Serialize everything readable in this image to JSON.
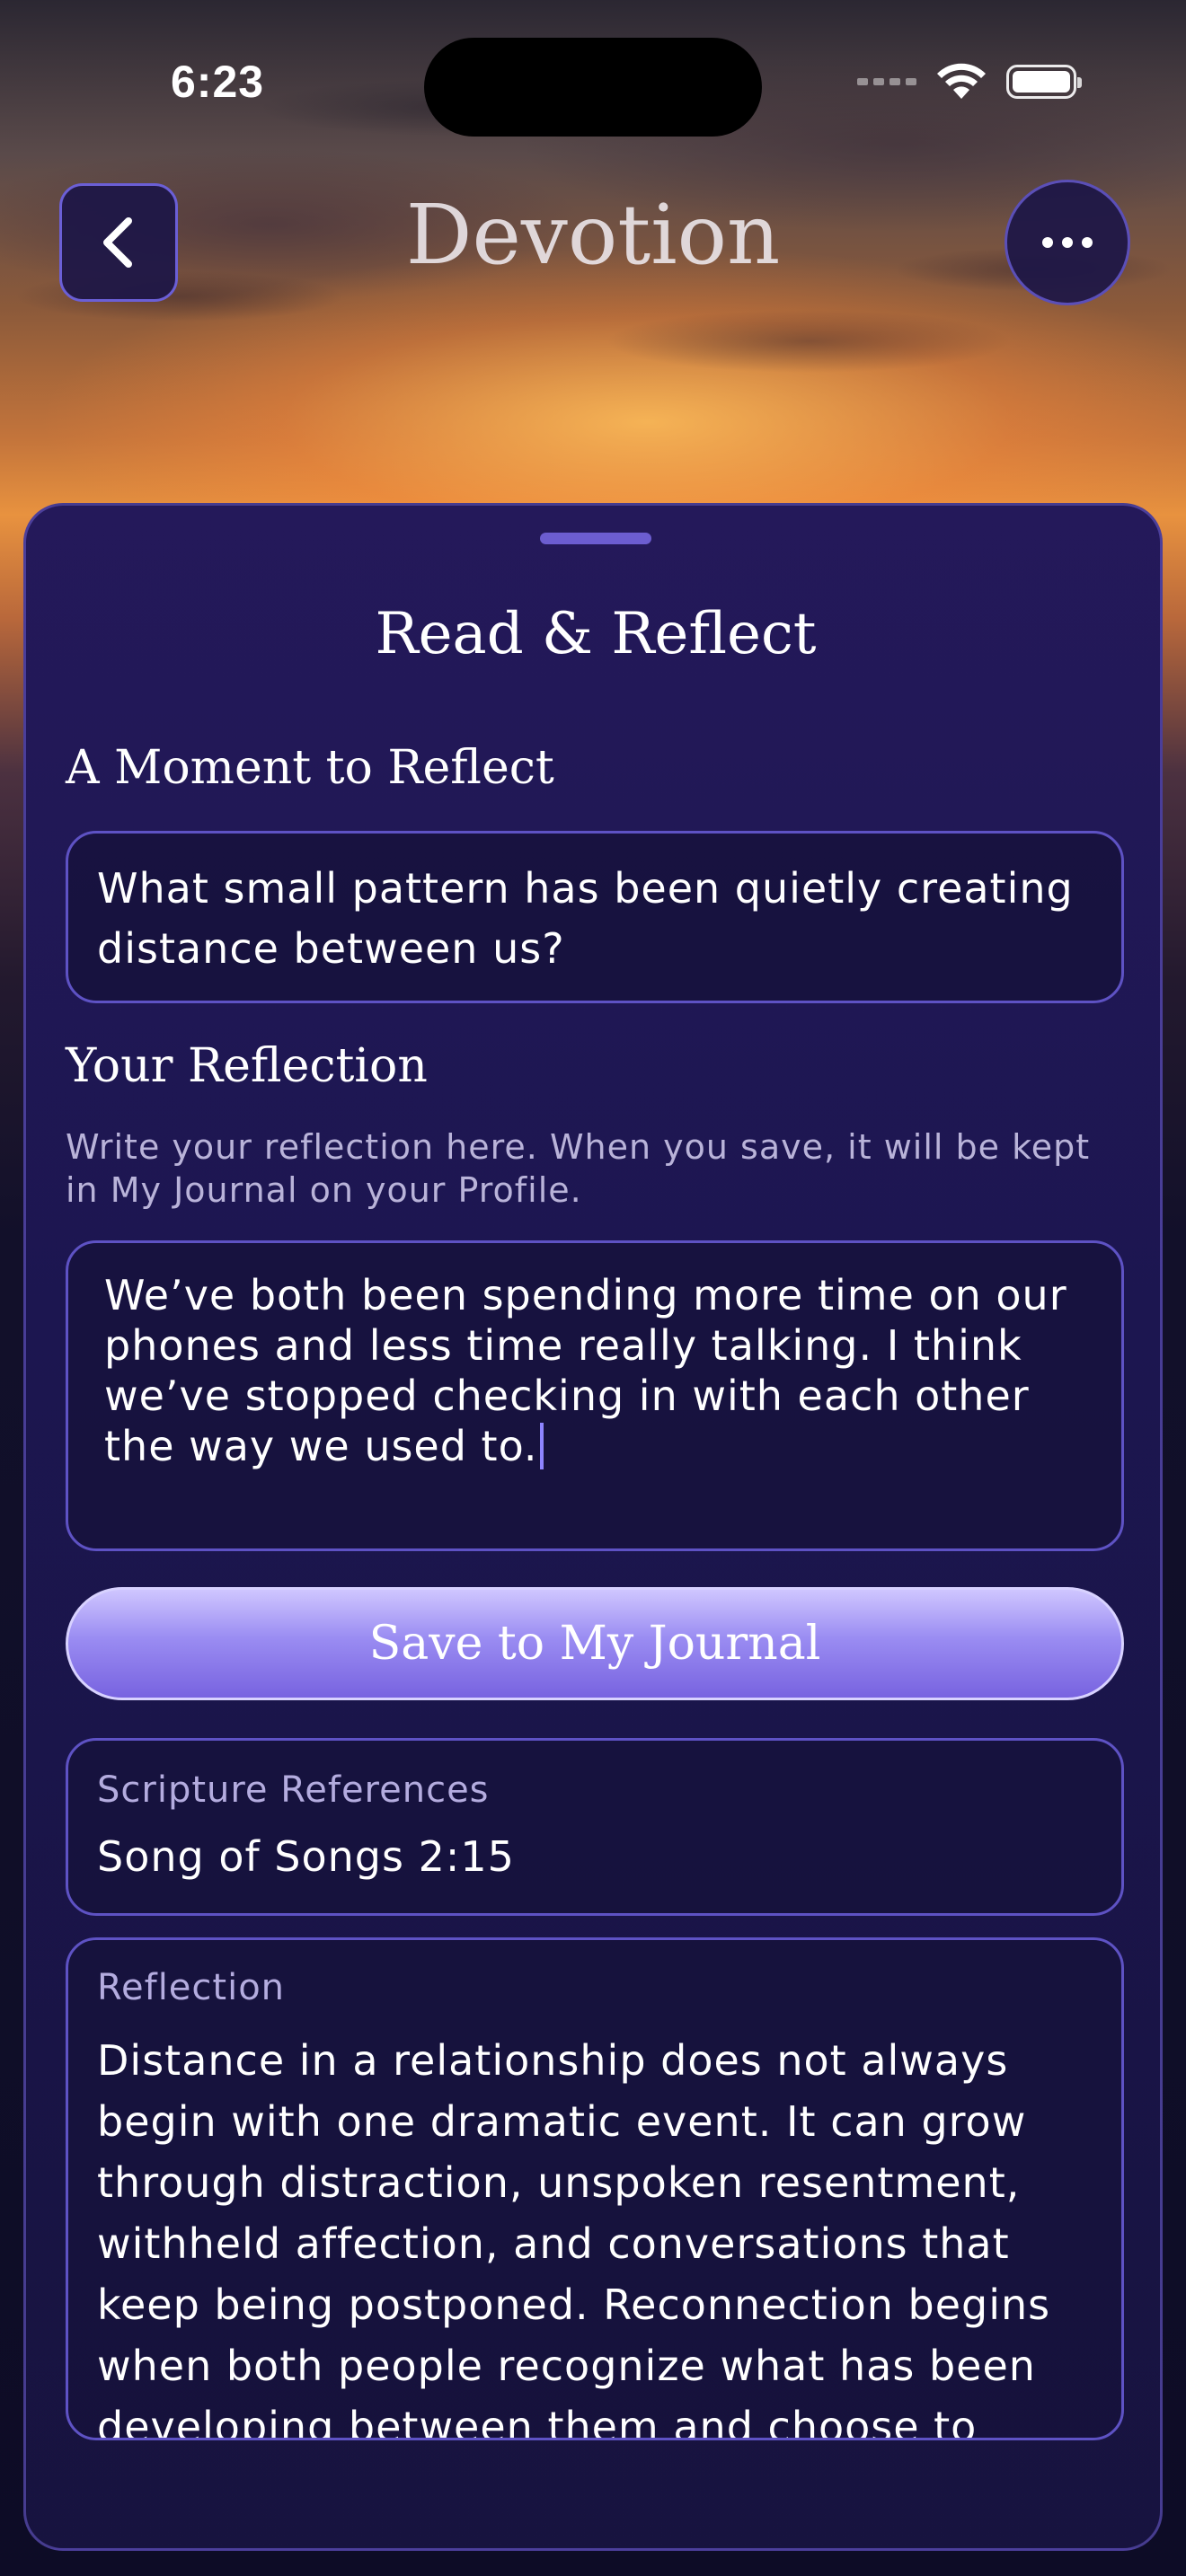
{
  "status_bar": {
    "time": "6:23"
  },
  "nav": {
    "title": "Devotion"
  },
  "sheet": {
    "title": "Read & Reflect",
    "moment_heading": "A Moment to Reflect",
    "prompt": "What small pattern has been quietly creating distance between us?",
    "reflection_heading": "Your Reflection",
    "reflection_hint": "Write your reflection here. When you save, it will be kept in My Journal on your Profile.",
    "reflection_value": "We’ve both been spending more time on our phones and less time really talking. I think we’ve stopped checking in with each other the way we used to.",
    "save_label": "Save to My Journal",
    "scripture": {
      "label": "Scripture References",
      "value": "Song of Songs 2:15"
    },
    "reflection_card": {
      "label": "Reflection",
      "body": "Distance in a relationship does not always begin with one dramatic event. It can grow through distraction, unspoken resentment, withheld affection, and conversations that keep being postponed. Reconnection begins when both people recognize what has been developing between them and choose to"
    }
  },
  "colors": {
    "accent": "#7863e0",
    "card_border": "#5e52c4",
    "sheet_bg": "#1c1650"
  },
  "icons": [
    "chevron-left-icon",
    "ellipsis-icon",
    "wifi-icon",
    "battery-icon",
    "cellular-signal-icon"
  ]
}
